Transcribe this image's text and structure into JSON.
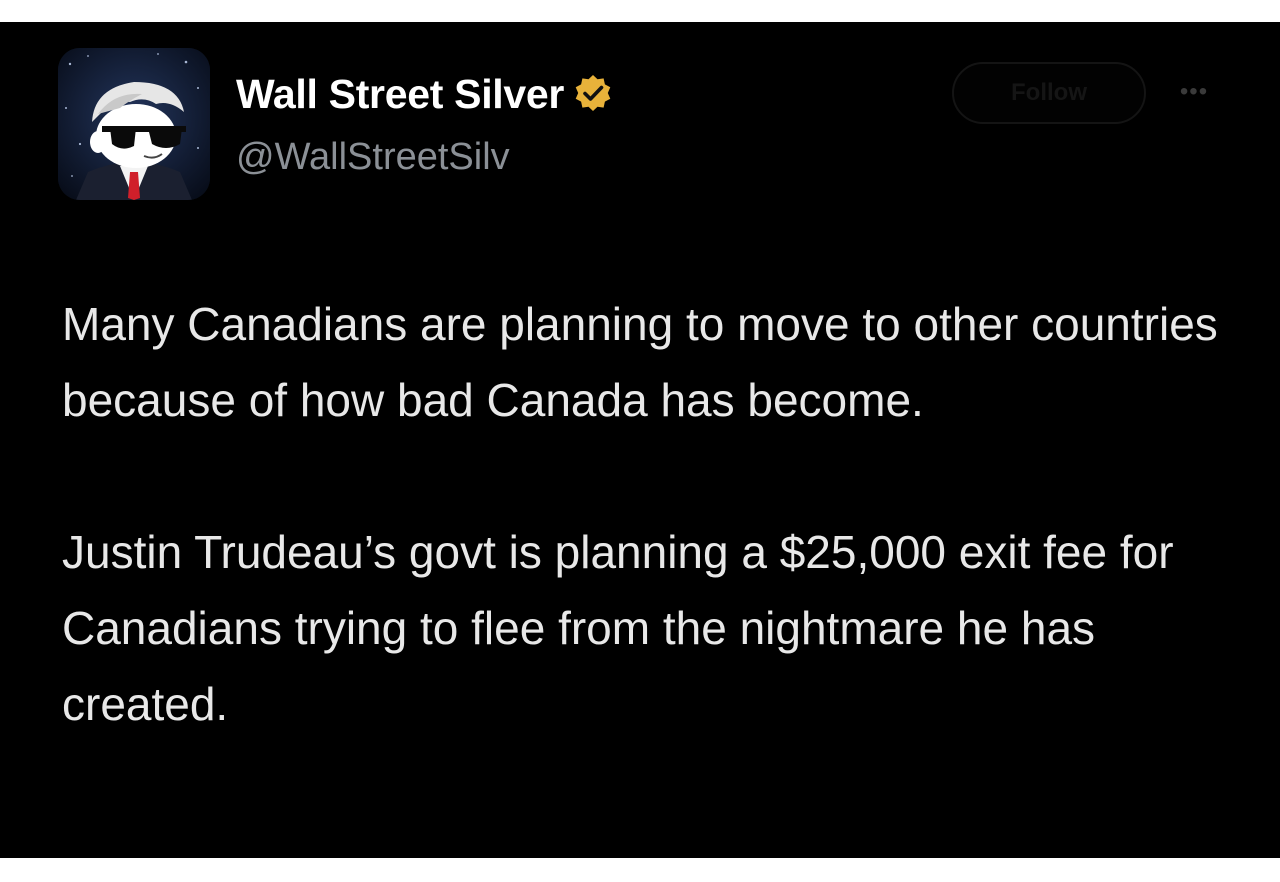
{
  "author": {
    "display_name": "Wall Street Silver",
    "handle": "@WallStreetSilv",
    "verified": true,
    "verified_badge_color": "#e8b23a",
    "avatar_icon": "sunglasses-mascot-avatar"
  },
  "actions": {
    "follow_label": "Follow",
    "more_icon": "more-horizontal-icon",
    "more_label": "•••"
  },
  "tweet": {
    "paragraphs": [
      "Many Canadians are planning to move to other countries because of how bad Canada has become.",
      "Justin Trudeau’s govt is planning a $25,000 exit fee for Canadians trying to flee from the nightmare he has created."
    ]
  },
  "colors": {
    "background": "#000000",
    "text_primary": "#e8e8e8",
    "text_secondary": "#8b9096"
  }
}
